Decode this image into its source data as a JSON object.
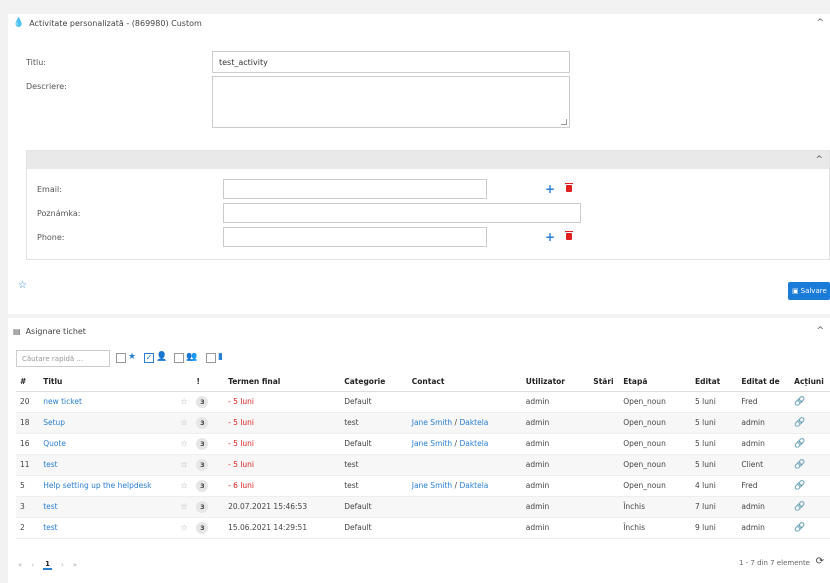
{
  "activity": {
    "title": "Activitate personalizată - (869980) Custom",
    "titlu_label": "Titlu:",
    "titlu_value": "test_activity",
    "descriere_label": "Descriere:",
    "email_label": "Email:",
    "poznamka_label": "Poznámka:",
    "phone_label": "Phone:",
    "save_label": "Salvare"
  },
  "ticket": {
    "title": "Asignare tichet",
    "search_placeholder": "Căutare rapidă ...",
    "columns": [
      "#",
      "Titlu",
      "!",
      "Termen final",
      "Categorie",
      "Contact",
      "Utilizator",
      "Stări",
      "Etapă",
      "Editat",
      "Editat de",
      "Acțiuni"
    ],
    "rows": [
      {
        "id": "20",
        "title": "new ticket",
        "prio": "3",
        "deadline": "- 5 luni",
        "category": "Default",
        "contact_a": "",
        "contact_sep": "",
        "contact_b": "",
        "user": "admin",
        "stage": "Open_noun",
        "edited": "5 luni",
        "edited_by": "Fred"
      },
      {
        "id": "18",
        "title": "Setup",
        "prio": "3",
        "deadline": "- 5 luni",
        "category": "test",
        "contact_a": "Jane Smith",
        "contact_sep": " / ",
        "contact_b": "Daktela",
        "user": "admin",
        "stage": "Open_noun",
        "edited": "5 luni",
        "edited_by": "admin"
      },
      {
        "id": "16",
        "title": "Quote",
        "prio": "3",
        "deadline": "- 5 luni",
        "category": "Default",
        "contact_a": "Jane Smith",
        "contact_sep": " / ",
        "contact_b": "Daktela",
        "user": "admin",
        "stage": "Open_noun",
        "edited": "5 luni",
        "edited_by": "admin"
      },
      {
        "id": "11",
        "title": "test",
        "prio": "3",
        "deadline": "- 5 luni",
        "category": "test",
        "contact_a": "",
        "contact_sep": "",
        "contact_b": "",
        "user": "admin",
        "stage": "Open_noun",
        "edited": "5 luni",
        "edited_by": "Client"
      },
      {
        "id": "5",
        "title": "Help setting up the helpdesk",
        "prio": "3",
        "deadline": "- 6 luni",
        "category": "test",
        "contact_a": "Jane Smith",
        "contact_sep": " / ",
        "contact_b": "Daktela",
        "user": "admin",
        "stage": "Open_noun",
        "edited": "4 luni",
        "edited_by": "Fred"
      },
      {
        "id": "3",
        "title": "test",
        "prio": "3",
        "deadline": "20.07.2021 15:46:53",
        "category": "Default",
        "contact_a": "",
        "contact_sep": "",
        "contact_b": "",
        "user": "admin",
        "stage": "Închis",
        "edited": "7 luni",
        "edited_by": "admin"
      },
      {
        "id": "2",
        "title": "test",
        "prio": "3",
        "deadline": "15.06.2021 14:29:51",
        "category": "Default",
        "contact_a": "",
        "contact_sep": "",
        "contact_b": "",
        "user": "admin",
        "stage": "Închis",
        "edited": "9 luni",
        "edited_by": "admin"
      }
    ],
    "pager_first": "«",
    "pager_prev": "‹",
    "pager_current": "1",
    "pager_next": "›",
    "pager_last": "»",
    "count_text": "1 - 7 din 7 elemente"
  },
  "colors": {
    "accent": "#2a7fd4",
    "danger": "#e02020"
  }
}
